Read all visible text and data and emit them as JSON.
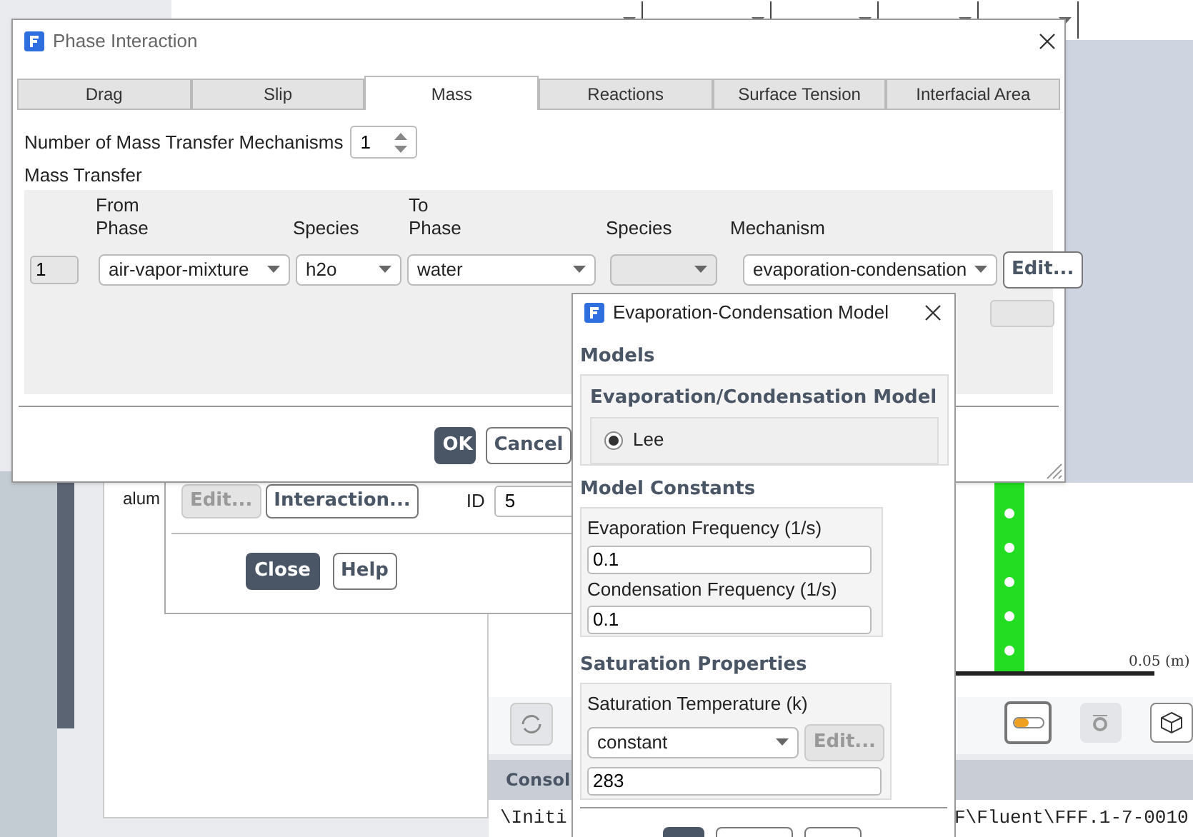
{
  "background": {
    "panel_text": "alum",
    "phases_dialog": {
      "buttons": [
        {
          "label": "Edit...",
          "disabled": true
        },
        {
          "label": "Interaction...",
          "disabled": false
        }
      ],
      "id_label": "ID",
      "id_value": "5",
      "close": "Close",
      "help": "Help"
    },
    "scale_label": "0.05 (m)",
    "console": {
      "title": "Consol",
      "line_left": "\\Initi",
      "line_right": "F\\Fluent\\FFF.1-7-0010"
    }
  },
  "phase_interaction": {
    "title": "Phase Interaction",
    "tabs": [
      {
        "label": "Drag",
        "selected": false
      },
      {
        "label": "Slip",
        "selected": false
      },
      {
        "label": "Mass",
        "selected": true
      },
      {
        "label": "Reactions",
        "selected": false
      },
      {
        "label": "Surface Tension",
        "selected": false
      },
      {
        "label": "Interfacial Area",
        "selected": false
      }
    ],
    "mechanisms_label": "Number of Mass Transfer Mechanisms",
    "mechanisms_value": "1",
    "section": "Mass Transfer",
    "columns": [
      "From\nPhase",
      "Species",
      "To\nPhase",
      "Species",
      "Mechanism"
    ],
    "rows": [
      {
        "index": "1",
        "from_phase": "air-vapor-mixture",
        "species": "h2o",
        "to_phase": "water",
        "mechanism": "evaporation-condensation",
        "edit": "Edit..."
      }
    ],
    "buttons": [
      {
        "label": "OK",
        "kind": "primary"
      },
      {
        "label": "Cancel",
        "kind": "secondary"
      }
    ]
  },
  "evap_dialog": {
    "title": "Evaporation-Condensation Model",
    "models_heading": "Models",
    "model_group": "Evaporation/Condensation Model",
    "options": [
      {
        "label": "Lee",
        "selected": true
      }
    ],
    "constants_heading": "Model Constants",
    "constants": [
      {
        "label": "Evaporation Frequency (1/s)",
        "value": "0.1"
      },
      {
        "label": "Condensation Frequency (1/s)",
        "value": "0.1"
      }
    ],
    "saturation_heading": "Saturation Properties",
    "saturation_label": "Saturation Temperature (k)",
    "saturation_method": "constant",
    "saturation_edit": {
      "label": "Edit...",
      "disabled": true
    },
    "saturation_value": "283"
  }
}
